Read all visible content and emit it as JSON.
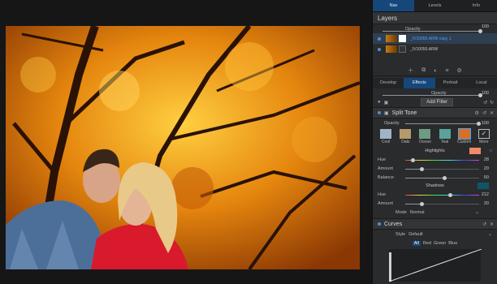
{
  "top_tabs": [
    "Nav",
    "Levels",
    "Info"
  ],
  "layers": {
    "title": "Layers",
    "opacity_label": "Opacity",
    "opacity_value": "100",
    "items": [
      {
        "name": "_IV10050.ARW copy 1",
        "selected": true
      },
      {
        "name": "_IV10050.ARW",
        "selected": false
      }
    ]
  },
  "mode_tabs": [
    "Develop",
    "Effects",
    "Portrait",
    "Local"
  ],
  "effects": {
    "opacity_label": "Opacity",
    "opacity_value": "100",
    "add_filter_label": "Add Filter"
  },
  "split_tone": {
    "title": "Split Tone",
    "opacity_label": "Opacity",
    "opacity_value": "100",
    "presets": [
      {
        "name": "Cool",
        "color": "#9fb4c6"
      },
      {
        "name": "Oats",
        "color": "#b59a6b"
      },
      {
        "name": "Ocean",
        "color": "#6e9b86"
      },
      {
        "name": "Teal",
        "color": "#5aa39a"
      },
      {
        "name": "Custom",
        "color": "#d96f25"
      },
      {
        "name": "More",
        "color": "#2a2b2d"
      }
    ],
    "highlights_label": "Highlights",
    "highlights_color": "#f08a6a",
    "hue_label": "Hue",
    "hue_value": "28",
    "amount_label": "Amount",
    "amount_value": "20",
    "balance_label": "Balance",
    "balance_value": "50",
    "shadows_label": "Shadows",
    "shadows_color": "#0f5568",
    "s_hue_label": "Hue",
    "s_hue_value": "212",
    "s_amount_label": "Amount",
    "s_amount_value": "20",
    "mode_label": "Mode",
    "mode_value": "Normal"
  },
  "curves": {
    "title": "Curves",
    "style_label": "Style",
    "style_value": "Default",
    "channels": [
      "All",
      "Red",
      "Green",
      "Blue"
    ]
  }
}
